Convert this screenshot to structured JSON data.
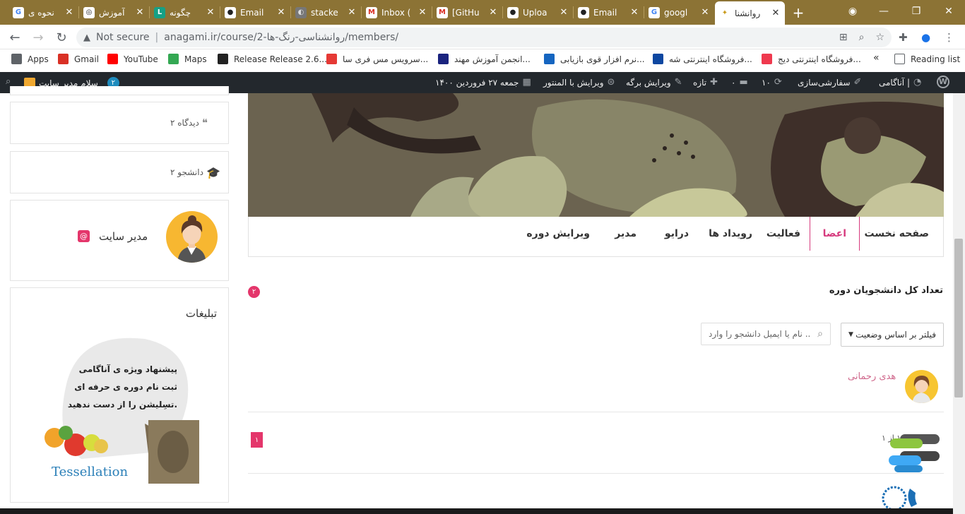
{
  "browser": {
    "tabs": [
      {
        "title": "نحوه ی",
        "fav": "G",
        "favbg": "#fff",
        "favfg": "#4285f4"
      },
      {
        "title": "آموزش",
        "fav": "◎",
        "favbg": "#fff",
        "favfg": "#222"
      },
      {
        "title": "چگونه",
        "fav": "L",
        "favbg": "#16a085",
        "favfg": "#fff"
      },
      {
        "title": "Email",
        "fav": "●",
        "favbg": "#fff",
        "favfg": "#222"
      },
      {
        "title": "stacke",
        "fav": "◐",
        "favbg": "#777",
        "favfg": "#ddd"
      },
      {
        "title": "Inbox (",
        "fav": "M",
        "favbg": "#fff",
        "favfg": "#d93025"
      },
      {
        "title": "[GitHu",
        "fav": "M",
        "favbg": "#fff",
        "favfg": "#d93025"
      },
      {
        "title": "Uploa",
        "fav": "●",
        "favbg": "#fff",
        "favfg": "#222"
      },
      {
        "title": "Email",
        "fav": "●",
        "favbg": "#fff",
        "favfg": "#222"
      },
      {
        "title": "googl",
        "fav": "G",
        "favbg": "#fff",
        "favfg": "#4285f4"
      },
      {
        "title": "روانشنا",
        "fav": "✦",
        "favbg": "#fff",
        "favfg": "#c99a1a"
      }
    ],
    "active_tab_index": 10,
    "new_tab": "+",
    "address": {
      "warning": "Not secure",
      "separator": "|",
      "url": "anagami.ir/course/2-روانشناسی-رنگ-ها/members/"
    },
    "bookmarks": [
      {
        "label": "Apps",
        "color": "#5f6368"
      },
      {
        "label": "Gmail",
        "color": "#d93025"
      },
      {
        "label": "YouTube",
        "color": "#ff0000"
      },
      {
        "label": "Maps",
        "color": "#34a853"
      },
      {
        "label": "Release Release 2.6....",
        "color": "#222"
      },
      {
        "label": "سرویس مس فری سا...",
        "color": "#e53935"
      },
      {
        "label": "انجمن آموزش مهند...",
        "color": "#1a237e"
      },
      {
        "label": "نرم افزار قوی بازیابی...",
        "color": "#1565c0"
      },
      {
        "label": "فروشگاه اینترنتی شه...",
        "color": "#0d47a1"
      },
      {
        "label": "فروشگاه اینترنتی دیج...",
        "color": "#ef394e"
      }
    ],
    "bookmarks_more": "«",
    "reading_list": "Reading list"
  },
  "wp": {
    "greeting": "سلام مدیر سایت",
    "notif_count": "۲",
    "site": "آناگامی |",
    "customize": "سفارشی‌سازی",
    "updates": "۱۰",
    "comments": "۰",
    "new": "تازه",
    "edit_page": "ویرایش برگه",
    "elementor": "ویرایش با المنتور",
    "date": "جمعه ۲۷ فروردین ۱۴۰۰"
  },
  "sidebar": {
    "comments": "۲ دیدگاه",
    "students": "۲ دانشجو",
    "admin_name": "مدیر سایت",
    "ads_title": "تبلیغات",
    "ad_line1": "پیشنهاد ویژه ی آناگامی",
    "ad_line2": "ثبت نام دوره ی حرفه ای",
    "ad_line3": "تسِلیشن را از دست ندهید.",
    "ad_brand": "Tessellation"
  },
  "course_nav": {
    "items": [
      "صفحه نخست",
      "اعضا",
      "فعالیت",
      "رویداد ها",
      "درایو",
      "مدیر",
      "ویرایش دوره"
    ],
    "active_index": 1
  },
  "members": {
    "count_label": "تعداد کل دانشجویان دوره",
    "count": "۲",
    "filter_label": "فیلتر بر اساس وضعیت",
    "search_placeholder": "نام یا ایمیل دانشجو را وارد ...",
    "list": [
      {
        "name": "هدی رحمانی"
      }
    ],
    "page_current": "۱",
    "page_info": "صفحه ۱ از ۱"
  },
  "colors": {
    "accent": "#e4366b",
    "wpbar": "#23282d",
    "tabstrip": "#8c7335"
  }
}
